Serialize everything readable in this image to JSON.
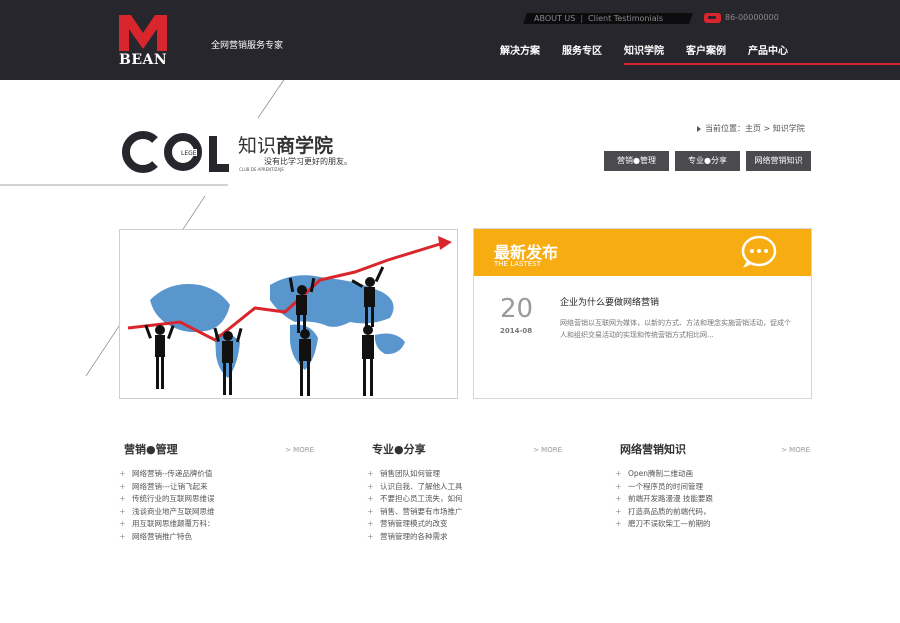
{
  "header": {
    "logo_text": "BEAN",
    "slogan": "全网营销服务专家",
    "top_links": [
      "ABOUT US",
      "Client Testimonials"
    ],
    "phone": "86-00000000",
    "nav": [
      "解决方案",
      "服务专区",
      "知识学院",
      "客户案例",
      "产品中心"
    ],
    "nav_active_index": 2
  },
  "college": {
    "logo_word": "COL",
    "logo_small": "LEGE",
    "logo_caption": "CLUB DE APRENTIZAJE",
    "title_light": "知识",
    "title_bold": "商学院",
    "subtitle": "没有比学习更好的朋友。"
  },
  "breadcrumb": {
    "label": "当前位置：",
    "home": "主页",
    "separator": ">",
    "current": "知识学院"
  },
  "category_buttons": [
    "营销●管理",
    "专业●分享",
    "网络营销知识"
  ],
  "latest": {
    "title": "最新发布",
    "subtitle": "THE LASTEST",
    "day": "20",
    "year_month": "2014-08",
    "news_title": "企业为什么要做网络营销",
    "news_desc": "网络营销以互联网为媒体，以新的方式、方法和理念实施营销活动，促成个人和组织交易活动的实现和传统营销方式相比网..."
  },
  "columns": [
    {
      "name": "营销●管理",
      "more": "> MORE",
      "items": [
        "网络营销--传递品牌价值",
        "网络营销---让销飞起来",
        "传统行业的互联网思维误",
        "浅谈商业地产互联网思维",
        "用互联网思维颠覆万科：",
        "网络营销推广特色"
      ]
    },
    {
      "name": "专业●分享",
      "more": "> MORE",
      "items": [
        "销售团队如何管理",
        "认识自我、了解他人工具",
        "不要担心员工流失，如何",
        "销售、营销要有市场推广",
        "营销管理模式的改变",
        "营销管理的各种需求"
      ]
    },
    {
      "name": "网络营销知识",
      "more": "> MORE",
      "items": [
        "Open腾制二维动画",
        "一个程序员的时间管理",
        "前端开发路漫漫 技能要跟",
        "打造高品质的前端代码，",
        "磨刀不误砍柴工—前期的"
      ]
    }
  ],
  "colors": {
    "header_bg": "#26262c",
    "brand_red": "#d9262c",
    "latest_orange": "#f7ad12",
    "button_gray": "#4a4a4f"
  }
}
